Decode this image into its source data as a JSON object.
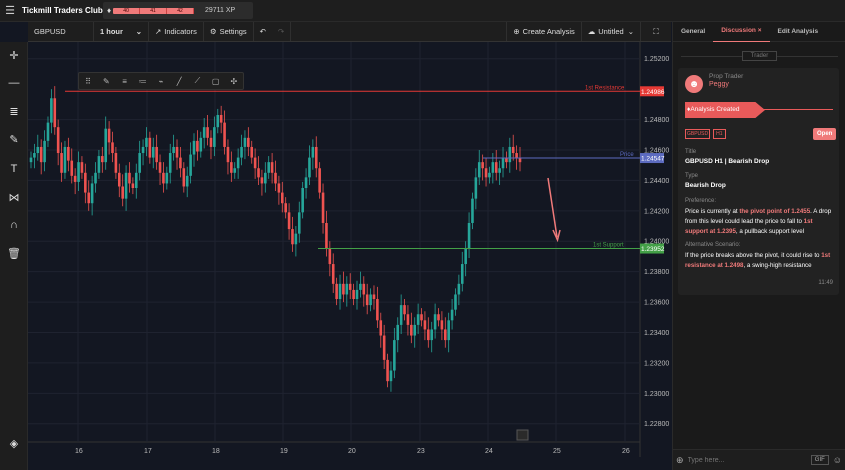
{
  "header": {
    "title": "Tickmill Traders Club",
    "xp_segments": [
      "40",
      "41",
      "42"
    ],
    "xp_total": "29711 XP"
  },
  "toolbar": {
    "symbol": "GBPUSD",
    "interval": "1 hour",
    "indicators": "Indicators",
    "settings": "Settings",
    "create_analysis": "Create Analysis",
    "layout_name": "Untitled"
  },
  "chart_data": {
    "type": "candlestick",
    "symbol": "GBPUSD",
    "timeframe": "1 hour",
    "y_ticks": [
      "1.25200",
      "1.24800",
      "1.24600",
      "1.24400",
      "1.24200",
      "1.24000",
      "1.23800",
      "1.23600",
      "1.23400",
      "1.23200",
      "1.23000",
      "1.22800"
    ],
    "ylim": [
      1.2268,
      1.2531
    ],
    "x_ticks": [
      "16",
      "17",
      "18",
      "19",
      "20",
      "23",
      "24",
      "25",
      "26"
    ],
    "levels": [
      {
        "label": "1st Resistance",
        "price": "1.24986",
        "color": "#e53935"
      },
      {
        "label": "Price",
        "price": "1.24547",
        "color": "#5c6bc0"
      },
      {
        "label": "1st Support",
        "price": "1.23952",
        "color": "#43a047"
      }
    ],
    "prices": [
      1.2455,
      1.2458,
      1.2462,
      1.2452,
      1.2466,
      1.2478,
      1.2494,
      1.2475,
      1.2458,
      1.2445,
      1.2462,
      1.2453,
      1.2443,
      1.2439,
      1.2452,
      1.2445,
      1.2432,
      1.2425,
      1.2438,
      1.2445,
      1.2456,
      1.2452,
      1.2474,
      1.2465,
      1.2458,
      1.2445,
      1.2436,
      1.2428,
      1.2445,
      1.2438,
      1.2435,
      1.2445,
      1.2458,
      1.2462,
      1.2468,
      1.2455,
      1.2462,
      1.2452,
      1.2445,
      1.2438,
      1.2445,
      1.2458,
      1.2462,
      1.2455,
      1.2448,
      1.2436,
      1.2443,
      1.2457,
      1.2466,
      1.2459,
      1.2468,
      1.2475,
      1.2468,
      1.2462,
      1.2475,
      1.2483,
      1.2478,
      1.2462,
      1.2452,
      1.2445,
      1.2448,
      1.2455,
      1.2462,
      1.2468,
      1.2462,
      1.2455,
      1.2448,
      1.2442,
      1.2438,
      1.2445,
      1.2452,
      1.2445,
      1.2438,
      1.2432,
      1.2425,
      1.2419,
      1.2408,
      1.2398,
      1.2405,
      1.2419,
      1.2435,
      1.2442,
      1.2455,
      1.2462,
      1.2448,
      1.2432,
      1.2412,
      1.2395,
      1.2385,
      1.2372,
      1.2362,
      1.2372,
      1.2365,
      1.2372,
      1.2368,
      1.2362,
      1.2368,
      1.2372,
      1.2365,
      1.2358,
      1.2365,
      1.2362,
      1.2348,
      1.2338,
      1.2322,
      1.2308,
      1.2315,
      1.2335,
      1.2345,
      1.2358,
      1.2352,
      1.2345,
      1.2338,
      1.2345,
      1.2352,
      1.2348,
      1.2342,
      1.2335,
      1.2342,
      1.2352,
      1.2348,
      1.2342,
      1.2335,
      1.2348,
      1.2355,
      1.2365,
      1.2372,
      1.2385,
      1.2395,
      1.2412,
      1.2428,
      1.2442,
      1.2452,
      1.2448,
      1.2442,
      1.2445,
      1.2452,
      1.2445,
      1.2448,
      1.2455,
      1.2452,
      1.2462,
      1.2458,
      1.2455,
      1.2452
    ]
  },
  "right_panel": {
    "tabs": [
      "General",
      "Discussion",
      "Edit Analysis"
    ],
    "trader_badge": "Trader",
    "role": "Prop Trader",
    "username": "Peggy",
    "status": "Analysis Created",
    "tags": [
      "GBPUSD",
      "H1"
    ],
    "open_button": "Open",
    "title_label": "Title",
    "title_value": "GBPUSD H1 | Bearish Drop",
    "type_label": "Type",
    "type_value": "Bearish Drop",
    "preference_label": "Preference:",
    "pref_p1": "Price is currently at ",
    "pref_h1": "the pivot point of 1.2455",
    "pref_p2": ". A drop from this level could lead the price to fall to ",
    "pref_h2": "1st support at 1.2395",
    "pref_p3": ", a pullback support level",
    "alt_label": "Alternative Scenario:",
    "alt_p1": "If the price breaks above the pivot, it could rise to ",
    "alt_h1": "1st resistance at 1.2498",
    "alt_p2": ", a swing-high resistance",
    "time": "11:49",
    "input_placeholder": "Type here...",
    "gif": "GIF"
  }
}
